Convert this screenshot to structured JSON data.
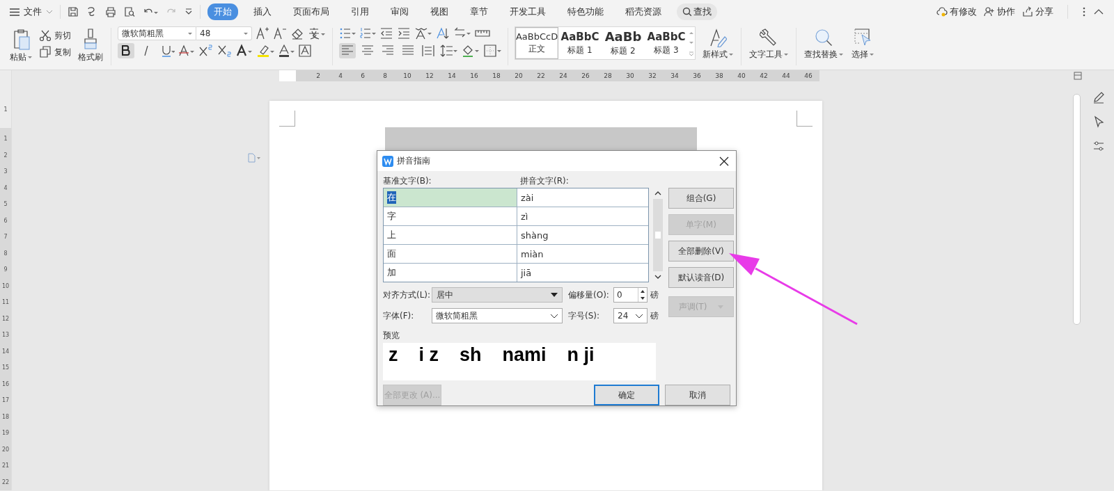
{
  "menu_bar": {
    "file_menu": "文件",
    "tabs": [
      {
        "label": "开始",
        "selected": true
      },
      {
        "label": "插入",
        "selected": false
      },
      {
        "label": "页面布局",
        "selected": false
      },
      {
        "label": "引用",
        "selected": false
      },
      {
        "label": "审阅",
        "selected": false
      },
      {
        "label": "视图",
        "selected": false
      },
      {
        "label": "章节",
        "selected": false
      },
      {
        "label": "开发工具",
        "selected": false
      },
      {
        "label": "特色功能",
        "selected": false
      },
      {
        "label": "稻壳资源",
        "selected": false
      }
    ],
    "search_button": "查找",
    "actions": [
      "有修改",
      "协作",
      "分享"
    ]
  },
  "ribbon": {
    "paste": "粘贴",
    "cut": "剪切",
    "copy": "复制",
    "format_painter": "格式刷",
    "font_name": "微软简粗黑",
    "font_size": "48",
    "bold": {
      "on": true
    },
    "italic": {
      "on": false
    },
    "underline": {
      "on": false
    },
    "alignment": [
      {
        "selected": true
      },
      {
        "selected": false
      },
      {
        "selected": false
      },
      {
        "selected": false
      },
      {
        "selected": false
      }
    ],
    "styles": [
      {
        "preview": "AaBbCcD",
        "label": "正文",
        "selected": true
      },
      {
        "preview": "AaBbC",
        "label": "标题 1",
        "selected": false
      },
      {
        "preview": "AaBb",
        "label": "标题 2",
        "selected": false
      },
      {
        "preview": "AaBbC",
        "label": "标题 3",
        "selected": false
      }
    ],
    "new_style": "新样式",
    "text_tools": "文字工具",
    "find_replace": "查找替换",
    "select": "选择"
  },
  "rulers": {
    "horizontal": [
      "2",
      "4",
      "6",
      "8",
      "10",
      "12",
      "14",
      "16",
      "18",
      "20",
      "22",
      "24",
      "26",
      "28",
      "30",
      "32",
      "34",
      "36",
      "38",
      "40",
      "42",
      "44",
      "46"
    ],
    "vertical": [
      "1",
      "1",
      "2",
      "3",
      "4",
      "5",
      "6",
      "7",
      "8",
      "9",
      "10",
      "11",
      "12",
      "13",
      "14",
      "15",
      "16",
      "17",
      "18",
      "19",
      "20",
      "21",
      "22"
    ]
  },
  "dialog": {
    "title": "拼音指南",
    "base_label": "基准文字(B):",
    "pinyin_label": "拼音文字(R):",
    "rows": [
      {
        "base": "在",
        "pinyin": "zài",
        "selected": true
      },
      {
        "base": "字",
        "pinyin": "zì",
        "selected": false
      },
      {
        "base": "上",
        "pinyin": "shàng",
        "selected": false
      },
      {
        "base": "面",
        "pinyin": "miàn",
        "selected": false
      },
      {
        "base": "加",
        "pinyin": "jiā",
        "selected": false
      }
    ],
    "buttons": [
      {
        "label": "组合(G)",
        "disabled": false
      },
      {
        "label": "单字(M)",
        "disabled": true
      },
      {
        "label": "全部删除(V)",
        "disabled": false
      },
      {
        "label": "默认读音(D)",
        "disabled": false
      }
    ],
    "alignment": {
      "label": "对齐方式(L):",
      "value": "居中"
    },
    "offset": {
      "label": "偏移量(O):",
      "value": "0",
      "unit": "磅"
    },
    "font": {
      "label": "字体(F):",
      "value": "微软简粗黑"
    },
    "size": {
      "label": "字号(S):",
      "value": "24",
      "unit": "磅"
    },
    "tone_button": {
      "label": "声调(T)",
      "disabled": true
    },
    "preview_label": "预览",
    "preview_text": "z    i z    sh    nami    n ji",
    "apply_all_button": {
      "label": "全部更改 (A)...",
      "disabled": true
    },
    "ok_button": {
      "label": "确定",
      "default": true
    },
    "cancel_button": "取消"
  }
}
